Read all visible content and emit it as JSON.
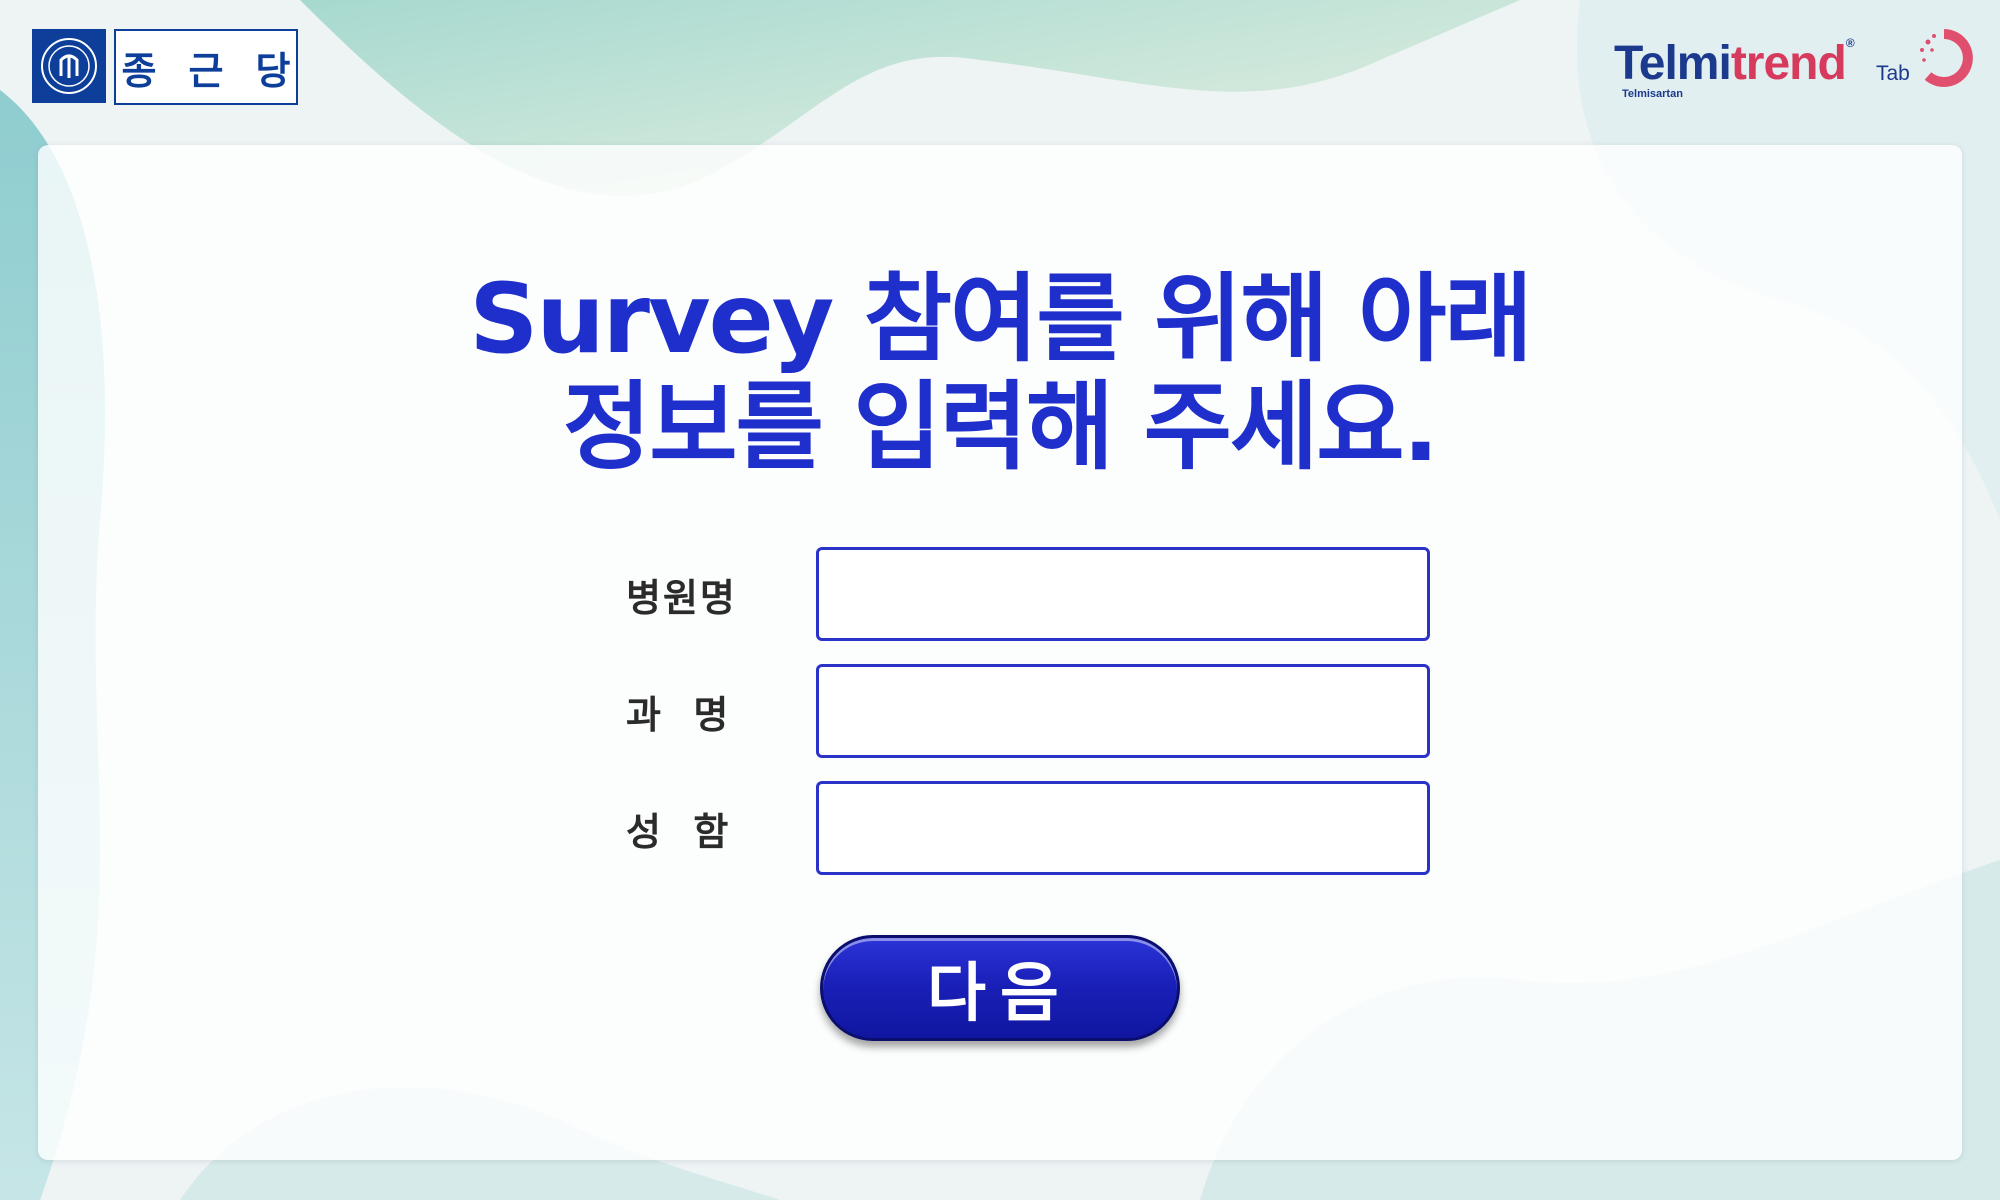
{
  "header": {
    "company_logo_text": [
      "종",
      "근",
      "당"
    ],
    "product_name_part1": "Telmi",
    "product_name_part2": "trend",
    "product_registered": "®",
    "product_form": "Tab",
    "product_generic": "Telmisartan"
  },
  "form": {
    "title_line1": "Survey 참여를 위해 아래",
    "title_line2": "정보를 입력해 주세요.",
    "fields": [
      {
        "label": "병원명",
        "value": ""
      },
      {
        "label": "과  명",
        "value": ""
      },
      {
        "label": "성  함",
        "value": ""
      }
    ],
    "next_label": "다음"
  },
  "colors": {
    "title": "#1f2fcc",
    "input_border": "#2a32c8",
    "button": "#1a20b8",
    "company_blue": "#0d3f9a",
    "brand_pink": "#d63a5c"
  },
  "icons": [
    "company-seal-icon",
    "brand-dots-icon"
  ]
}
